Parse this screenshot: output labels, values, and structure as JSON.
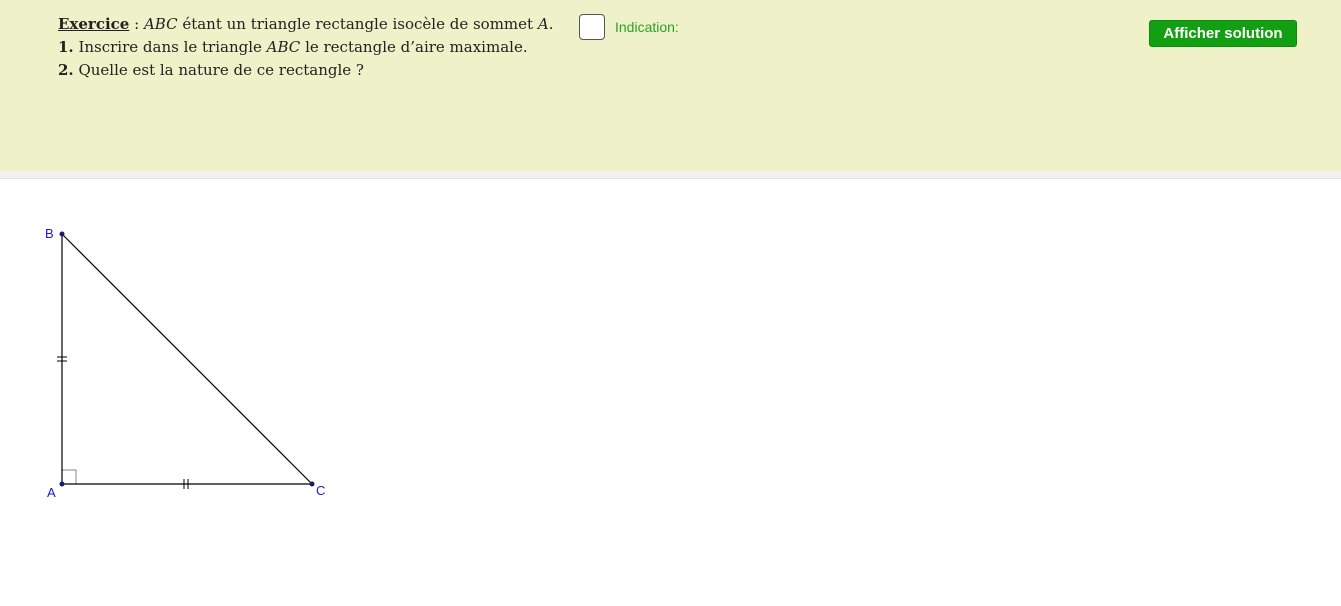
{
  "exercise": {
    "keyword": "Exercice",
    "intro_sep": " : ",
    "intro_math": "ABC",
    "intro_text": " étant un triangle rectangle isocèle de sommet ",
    "intro_vertex": "A",
    "intro_end": ".",
    "q1_num": "1.",
    "q1_text_a": " Inscrire dans le triangle ",
    "q1_math": "ABC",
    "q1_text_b": " le rectangle d’aire maximale.",
    "q2_num": "2.",
    "q2_text": " Quelle est la nature de ce rectangle ?"
  },
  "controls": {
    "indication_label": "Indication:",
    "indication_checked": false,
    "solution_button": "Afficher solution"
  },
  "figure": {
    "points": {
      "A": "A",
      "B": "B",
      "C": "C"
    },
    "colors": {
      "point_label": "#1a1ac8",
      "segment": "#000000",
      "header_bg": "#eff2c8",
      "button_bg": "#12a012",
      "indication_text": "#2aa02a"
    }
  }
}
